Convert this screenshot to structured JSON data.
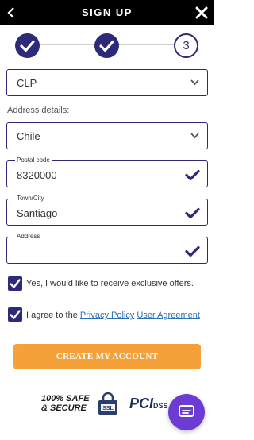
{
  "header": {
    "title": "SIGN UP",
    "close_icon": "close-icon",
    "back_icon": "back-arrow-icon"
  },
  "steps": {
    "current": "3",
    "done_icon": "checkmark-icon",
    "total": 3
  },
  "currency": {
    "value": "CLP"
  },
  "address": {
    "label": "Address details:",
    "country": "Chile",
    "postal_label": "Postal code",
    "postal_value": "8320000",
    "city_label": "Town/City",
    "city_value": "Santiago",
    "address_label": "Address",
    "address_value": ""
  },
  "checkboxes": {
    "offers": "Yes, I would like to receive exclusive offers.",
    "agree_prefix": "I agree to the ",
    "privacy": "Privacy Policy",
    "agreement": "User Agreement"
  },
  "cta": {
    "label": "CREATE MY ACCOUNT"
  },
  "badges": {
    "safe_line1": "100% SAFE",
    "safe_line2": "& SECURE",
    "ssl": "SSL",
    "pci": "PCI",
    "dss": "DSS"
  },
  "colors": {
    "primary": "#2e2a7a",
    "accent": "#f5a13a",
    "link": "#2a6fb3",
    "chat": "#6c3bd4"
  }
}
